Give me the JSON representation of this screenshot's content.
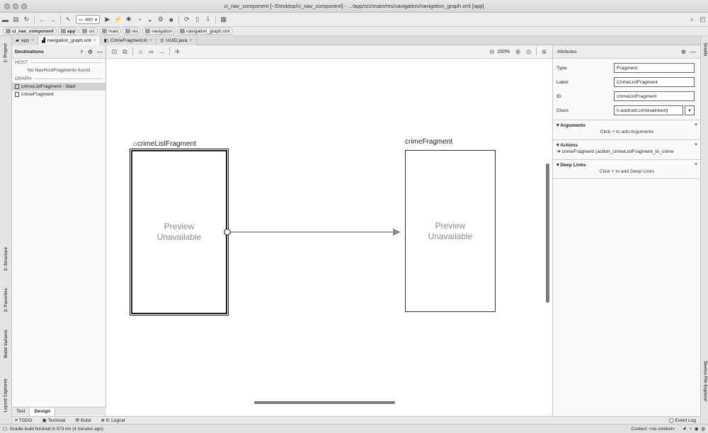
{
  "window": {
    "title": "ci_nav_component [~/Desktop/ci_nav_component] - .../app/src/main/res/navigation/navigation_graph.xml [app]"
  },
  "toolbar": {
    "run_config": "app"
  },
  "breadcrumb": [
    "ci_nav_component",
    "app",
    "src",
    "main",
    "res",
    "navigation",
    "navigation_graph.xml"
  ],
  "editor_tabs": [
    {
      "label": "app",
      "active": false
    },
    {
      "label": "navigation_graph.xml",
      "active": true
    },
    {
      "label": "CrimeFragment.kt",
      "active": false
    },
    {
      "label": "UUID.java",
      "active": false
    }
  ],
  "left_tools": [
    "1: Project",
    "2: Structure",
    "2: Favorites",
    "Build Variants",
    "Layout Captures"
  ],
  "right_tools": [
    "Gradle",
    "Device File Explorer"
  ],
  "destinations": {
    "title": "Destinations",
    "host_header": "HOST",
    "host_empty": "No NavHostFragments found",
    "graph_header": "GRAPH",
    "items": [
      {
        "label": "crimeListFragment - Start",
        "selected": true
      },
      {
        "label": "crimeFragment",
        "selected": false
      }
    ]
  },
  "graph_toolbar": {
    "zoom": "150%"
  },
  "canvas": {
    "start_fragment": {
      "title": "crimeListFragment",
      "preview_line1": "Preview",
      "preview_line2": "Unavailable"
    },
    "target_fragment": {
      "title": "crimeFragment",
      "preview_line1": "Preview",
      "preview_line2": "Unavailable"
    }
  },
  "attributes": {
    "title": "Attributes",
    "type_label": "Type",
    "type_value": "Fragment",
    "label_label": "Label",
    "label_value": "CrimeListFragment",
    "id_label": "ID",
    "id_value": "crimeListFragment",
    "class_label": "Class",
    "class_value": "h.android.criminalintent)",
    "arguments_header": "Arguments",
    "arguments_hint": "Click + to add Arguments",
    "actions_header": "Actions",
    "action_item": "crimeFragment (action_crimeListFragment_to_crime",
    "deeplinks_header": "Deep Links",
    "deeplinks_hint": "Click + to add Deep Links"
  },
  "design_tabs": {
    "text": "Text",
    "design": "Design"
  },
  "bottom_tools": {
    "todo": "TODO",
    "terminal": "Terminal",
    "build": "Build",
    "logcat": "6: Logcat",
    "event_log": "Event Log"
  },
  "status": {
    "message": "Gradle build finished in 573 ms (4 minutes ago)",
    "context": "Context: <no context>"
  }
}
